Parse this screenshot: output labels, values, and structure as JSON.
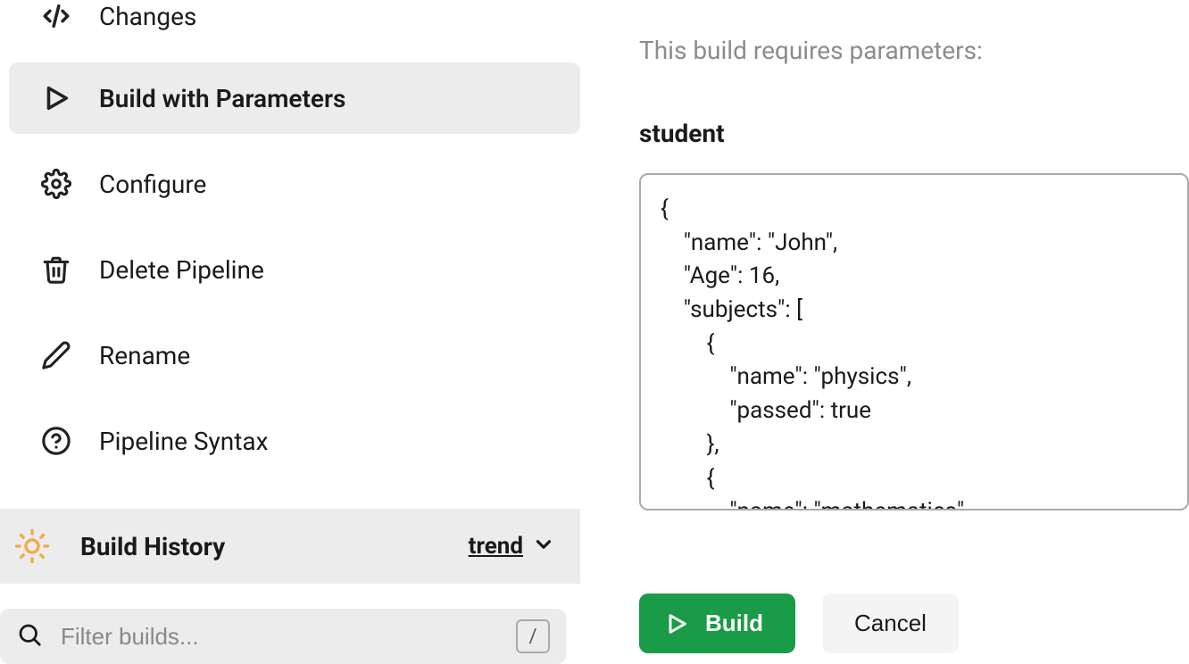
{
  "sidebar": {
    "items": [
      {
        "label": "Changes"
      },
      {
        "label": "Build with Parameters"
      },
      {
        "label": "Configure"
      },
      {
        "label": "Delete Pipeline"
      },
      {
        "label": "Rename"
      },
      {
        "label": "Pipeline Syntax"
      }
    ]
  },
  "history": {
    "title": "Build History",
    "trend_label": "trend"
  },
  "filter": {
    "placeholder": "Filter builds...",
    "shortcut": "/"
  },
  "main": {
    "heading": "This build requires parameters:",
    "param_name": "student",
    "param_value": "{\n    \"name\": \"John\",\n    \"Age\": 16,\n    \"subjects\": [\n        {\n            \"name\": \"physics\",\n            \"passed\": true\n        },\n        {\n            \"name\": \"mathematics\",",
    "build_label": "Build",
    "cancel_label": "Cancel"
  }
}
